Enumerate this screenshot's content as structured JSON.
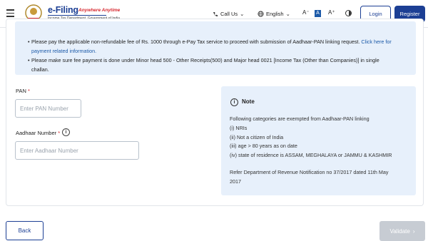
{
  "header": {
    "logo_text": "e-Filing",
    "logo_tagline": "Anywhere Anytime",
    "logo_sub": "Income Tax Department, Government of India",
    "call_us": "Call Us",
    "language": "English",
    "font_small": "A⁻",
    "font_normal": "A",
    "font_large": "A⁺",
    "login": "Login",
    "register": "Register"
  },
  "info_box": {
    "line1": "Please pay the applicable non-refundable fee of Rs. 1000 through e-Pay Tax service to proceed with submission of Aadhaar-PAN linking request.",
    "line1_link": "Click here for payment related information.",
    "line2": "Please make sure fee payment is done under Minor head 500 - Other Receipts(500) and Major head 0021 [Income Tax (Other than Companies)] in single challan."
  },
  "form": {
    "pan_label": "PAN",
    "pan_placeholder": "Enter PAN Number",
    "aadhaar_label": "Aadhaar Number",
    "aadhaar_placeholder": "Enter Aadhaar Number",
    "required_mark": "*"
  },
  "note": {
    "title": "Note",
    "intro": "Following categories are exempted from Aadhaar-PAN linking",
    "items": [
      "(i) NRIs",
      "(ii) Not a citizen of India",
      "(iii) age > 80 years as on date",
      "(iv) state of residence is ASSAM, MEGHALAYA or JAMMU & KASHMIR"
    ],
    "ref_line1": "Refer Department of Revenue Notification no 37/2017 dated 11th May",
    "ref_line2": "2017"
  },
  "footer": {
    "back": "Back",
    "validate": "Validate"
  },
  "colors": {
    "brand": "#1c3f94",
    "info_bg": "#e7f0fb",
    "required": "#d6262d",
    "disabled": "#c7ccd3"
  }
}
